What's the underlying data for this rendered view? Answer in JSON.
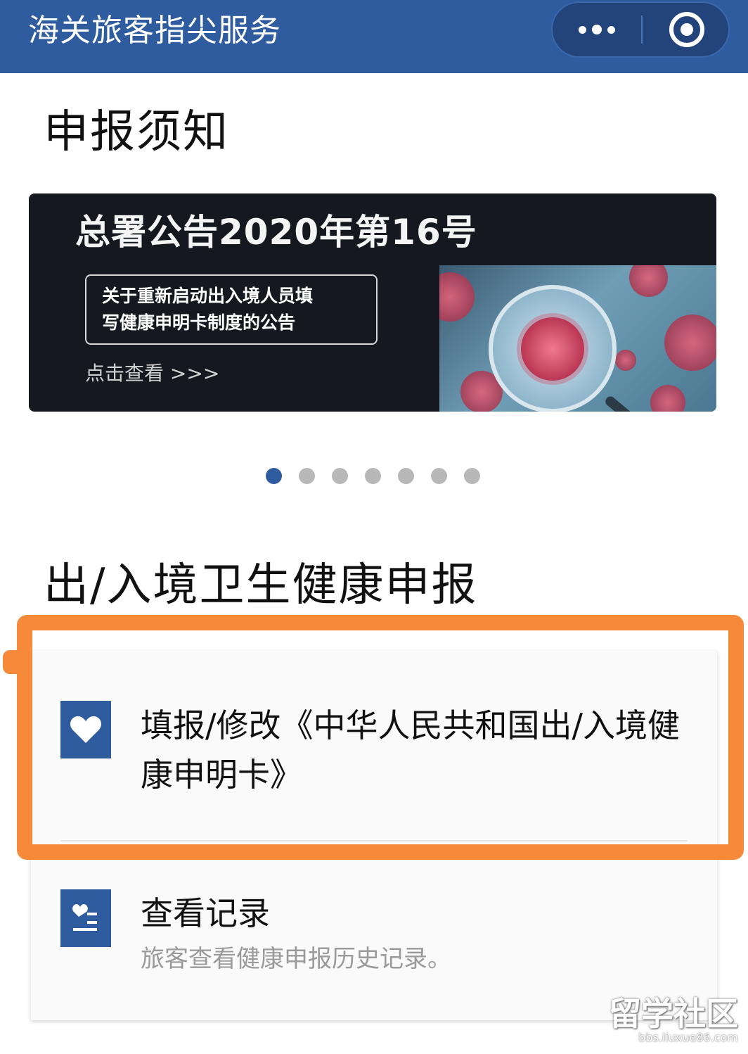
{
  "header": {
    "title": "海关旅客指尖服务",
    "more_icon": "more-dots-icon",
    "close_icon": "target-close-icon",
    "bar_color": "#2f5c9e"
  },
  "notice": {
    "section_title": "申报须知",
    "banner": {
      "headline": "总署公告2020年第16号",
      "subtitle_line1": "关于重新启动出入境人员填",
      "subtitle_line2": "写健康申明卡制度的公告",
      "link_text": "点击查看 >>>",
      "image": "virus-magnifier-image"
    },
    "carousel": {
      "total": 7,
      "active_index": 0
    }
  },
  "declaration": {
    "section_title": "出/入境卫生健康申报",
    "items": [
      {
        "icon": "heart-icon",
        "label": "填报/修改《中华人民共和国出/入境健康申明卡》"
      },
      {
        "icon": "health-record-icon",
        "label": "查看记录",
        "description": "旅客查看健康申报历史记录。"
      }
    ]
  },
  "highlight_color": "#f7893a",
  "watermark": {
    "main": "留学社区",
    "sub": "bbs.liuxue86.com"
  }
}
